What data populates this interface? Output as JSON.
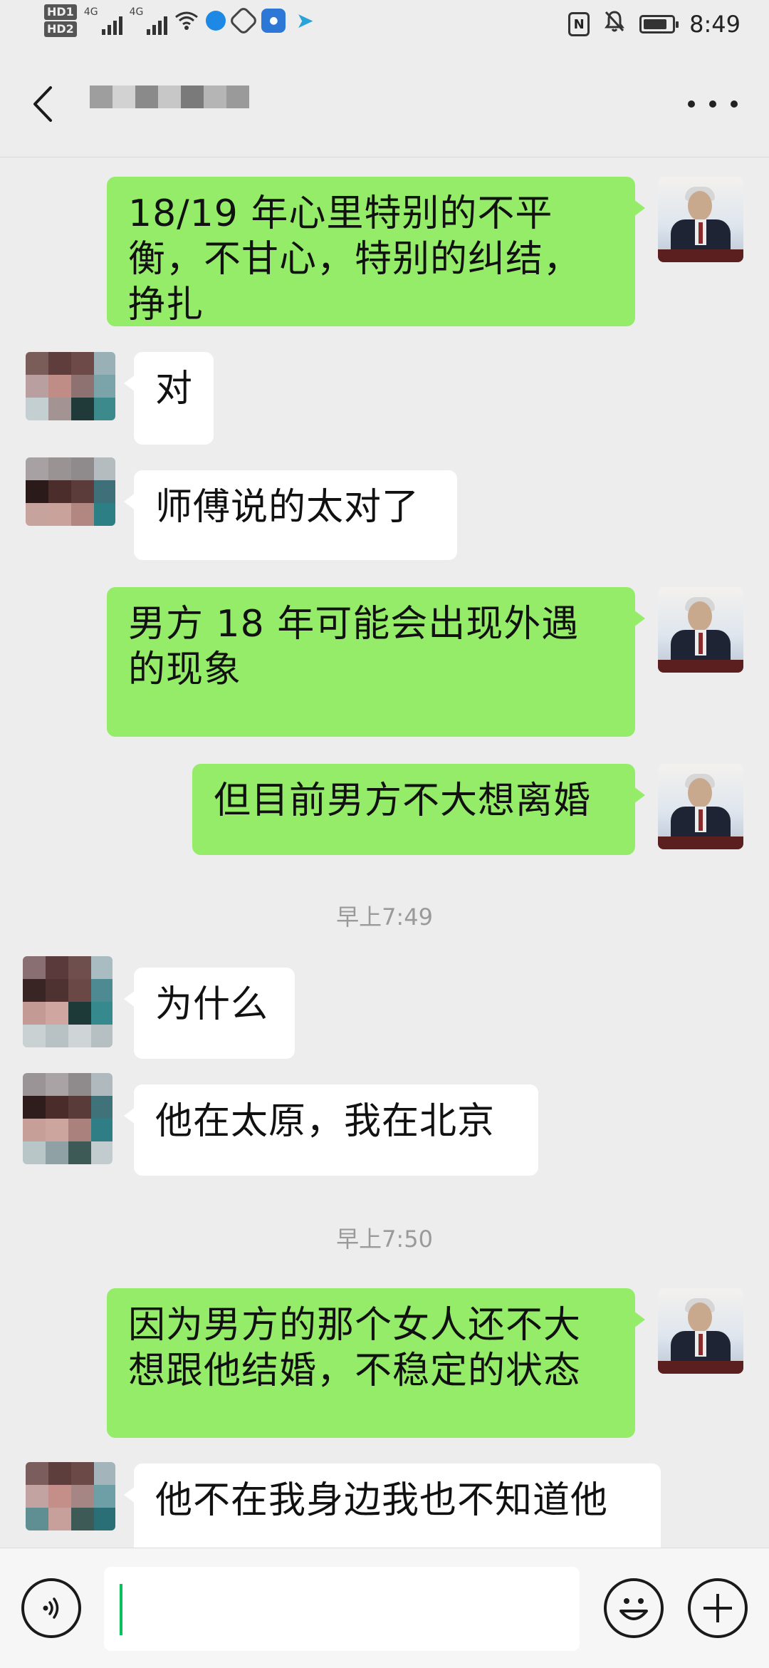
{
  "status_bar": {
    "hd1": "HD1",
    "hd2": "HD2",
    "network1": "4G",
    "network2": "4G",
    "time": "8:49",
    "icons": [
      "signal-icon",
      "wifi-icon",
      "browser-icon",
      "app-icon",
      "map-app-icon",
      "telegram-icon",
      "nfc-icon",
      "mute-bell-icon",
      "battery-icon"
    ]
  },
  "header": {
    "contact_name": ""
  },
  "messages": [
    {
      "from": "me",
      "text": "18/19 年心里特别的不平衡，不甘心，特别的纠结，挣扎"
    },
    {
      "from": "them",
      "text": "对"
    },
    {
      "from": "them",
      "text": "师傅说的太对了"
    },
    {
      "from": "me",
      "text": "男方 18 年可能会出现外遇的现象"
    },
    {
      "from": "me",
      "text": "但目前男方不大想离婚"
    },
    {
      "from": "time",
      "text": "早上7:49"
    },
    {
      "from": "them",
      "text": "为什么"
    },
    {
      "from": "them",
      "text": "他在太原，我在北京"
    },
    {
      "from": "time",
      "text": "早上7:50"
    },
    {
      "from": "me",
      "text": "因为男方的那个女人还不大想跟他结婚，不稳定的状态"
    },
    {
      "from": "them",
      "text": "他不在我身边我也不知道他"
    }
  ],
  "input": {
    "value": ""
  },
  "colors": {
    "background": "#ededed",
    "my_bubble": "#95ec69",
    "their_bubble": "#ffffff",
    "cursor": "#07c160"
  }
}
